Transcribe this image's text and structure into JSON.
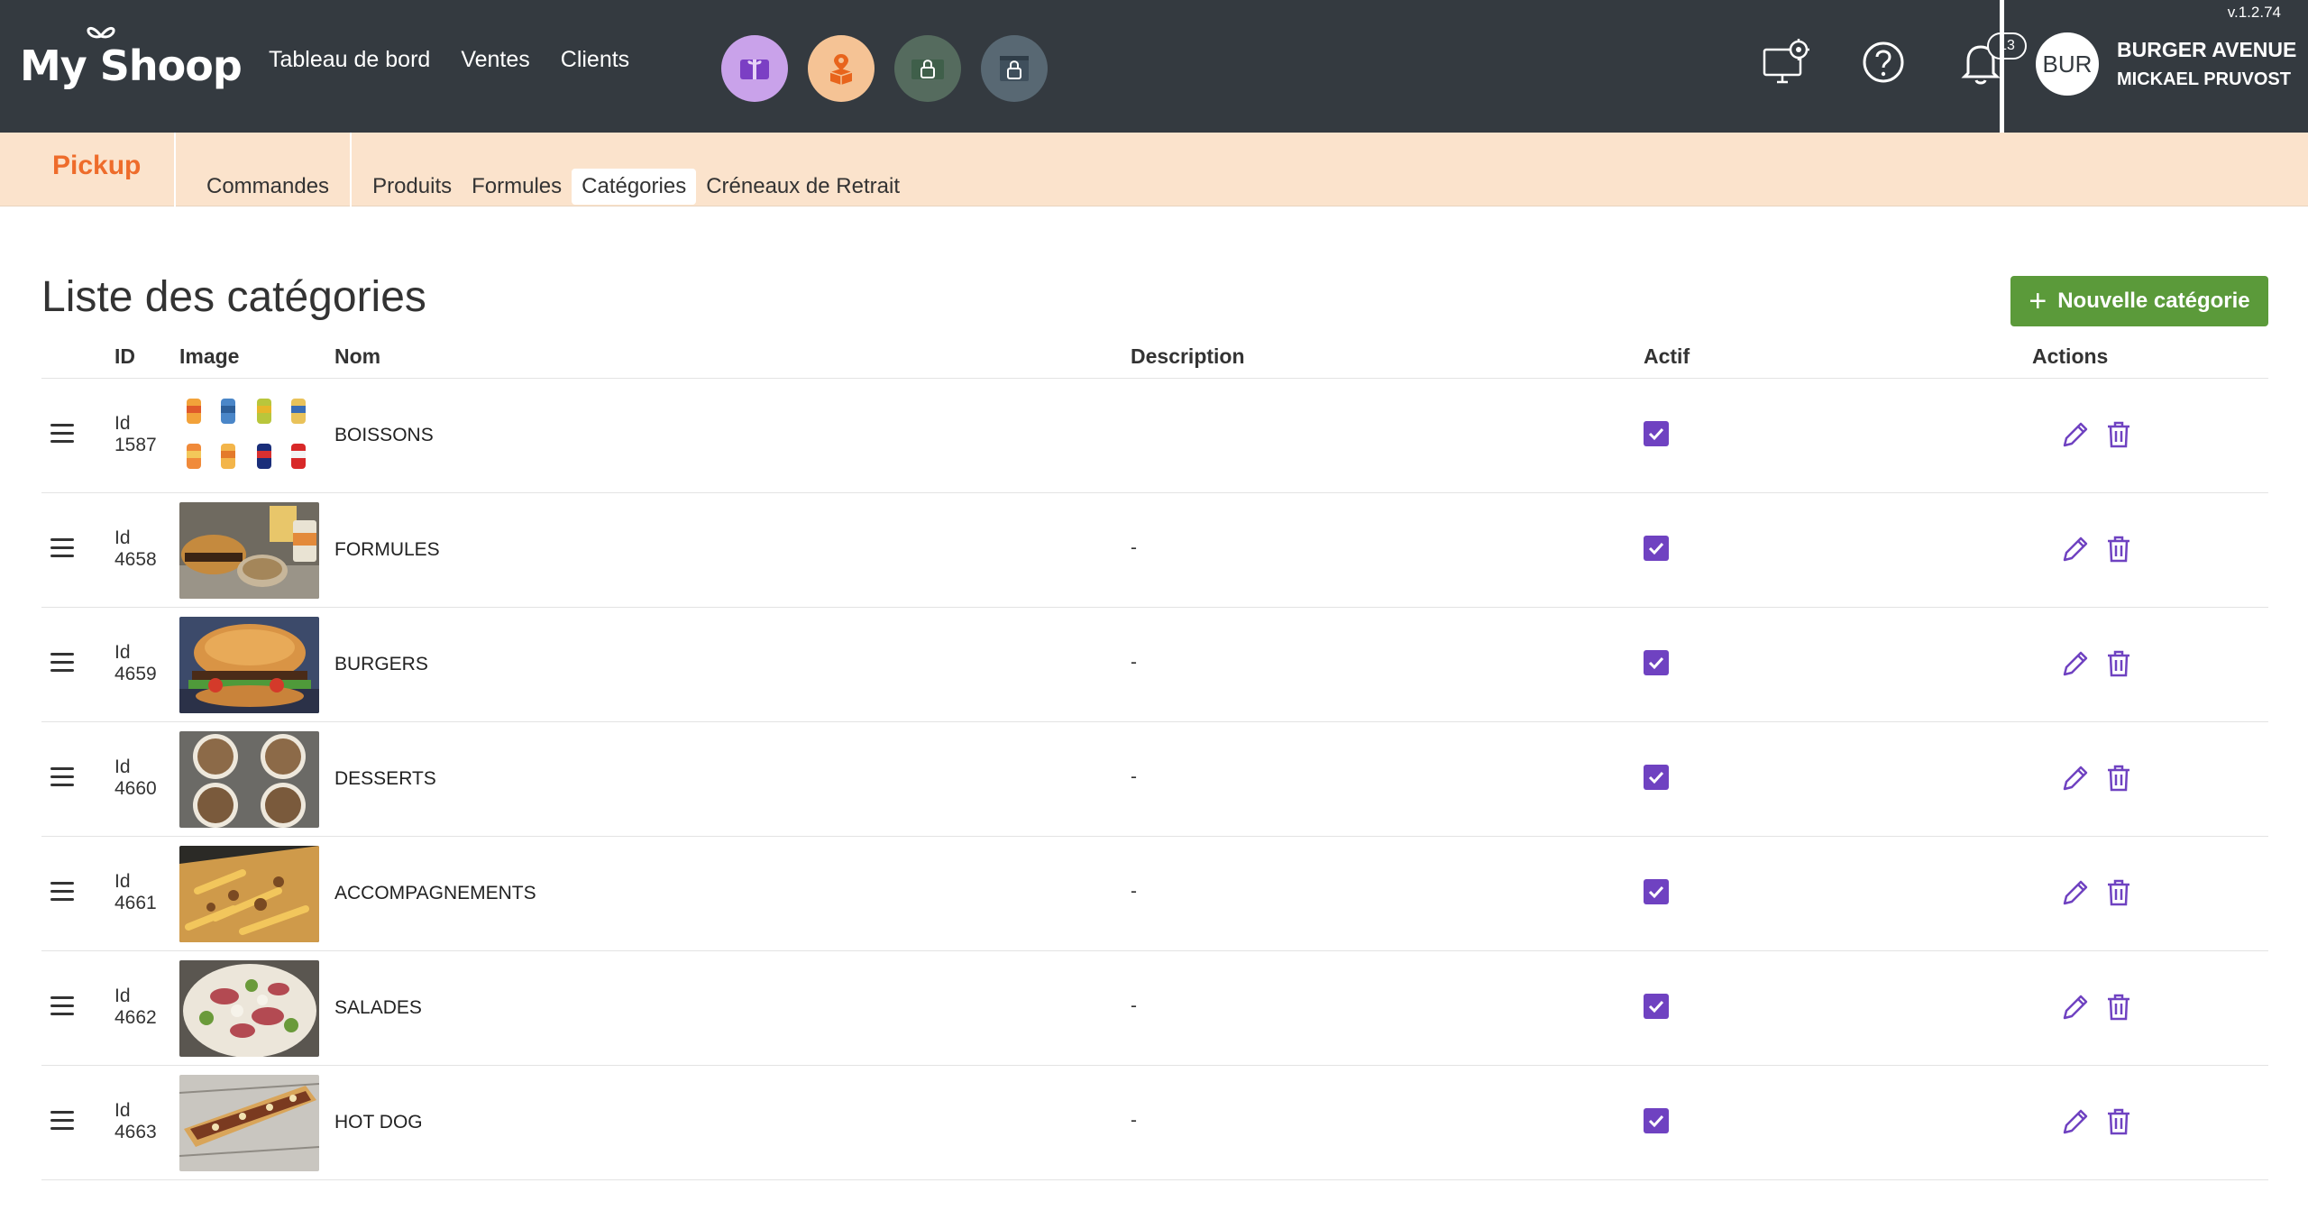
{
  "header": {
    "logo_text": "My Shoop",
    "version": "v.1.2.74",
    "nav": [
      "Tableau de bord",
      "Ventes",
      "Clients"
    ],
    "notifications_count": "13",
    "avatar_initials": "BUR",
    "user_name": "BURGER AVENUE",
    "user_sub": "MICKAEL PRUVOST",
    "app_icons": [
      {
        "name": "gift-card-icon",
        "bg": "#c9a2ea"
      },
      {
        "name": "delivery-box-icon",
        "bg": "#f5c395"
      },
      {
        "name": "locked-module-icon",
        "bg": "#556b5e"
      },
      {
        "name": "locked-window-icon",
        "bg": "#586873"
      }
    ]
  },
  "subnav": {
    "brand": "Pickup",
    "items": [
      "Commandes",
      "Produits",
      "Formules",
      "Catégories",
      "Créneaux de Retrait"
    ],
    "active": "Catégories"
  },
  "page": {
    "title": "Liste des catégories",
    "new_button": "Nouvelle catégorie"
  },
  "table": {
    "columns": {
      "id": "ID",
      "image": "Image",
      "name": "Nom",
      "description": "Description",
      "active": "Actif",
      "actions": "Actions"
    },
    "rows": [
      {
        "id_label": "Id",
        "id": "1587",
        "name": "BOISSONS",
        "description": "",
        "active": true,
        "image": "cans"
      },
      {
        "id_label": "Id",
        "id": "4658",
        "name": "FORMULES",
        "description": "-",
        "active": true,
        "image": "menu"
      },
      {
        "id_label": "Id",
        "id": "4659",
        "name": "BURGERS",
        "description": "-",
        "active": true,
        "image": "burger"
      },
      {
        "id_label": "Id",
        "id": "4660",
        "name": "DESSERTS",
        "description": "-",
        "active": true,
        "image": "desserts"
      },
      {
        "id_label": "Id",
        "id": "4661",
        "name": "ACCOMPAGNEMENTS",
        "description": "-",
        "active": true,
        "image": "fries"
      },
      {
        "id_label": "Id",
        "id": "4662",
        "name": "SALADES",
        "description": "-",
        "active": true,
        "image": "salad"
      },
      {
        "id_label": "Id",
        "id": "4663",
        "name": "HOT DOG",
        "description": "-",
        "active": true,
        "image": "hotdog"
      }
    ]
  },
  "colors": {
    "topbar": "#343a40",
    "subbar": "#fbe3cc",
    "brand_orange": "#ee6c2b",
    "accent_purple": "#6f42c1",
    "button_green": "#5b9a3a"
  }
}
